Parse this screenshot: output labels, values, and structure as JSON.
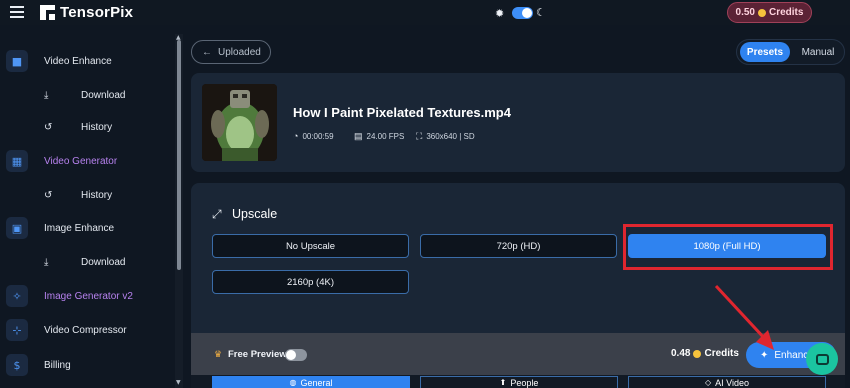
{
  "app": {
    "name": "TensorPix"
  },
  "header": {
    "credits": "0.50",
    "credits_label": "Credits",
    "theme_toggle": "dark"
  },
  "sidebar": {
    "items": [
      {
        "label": "Video Enhance",
        "icon": "video-camera-icon"
      },
      {
        "label": "Download",
        "icon": "download-icon",
        "sub": true
      },
      {
        "label": "History",
        "icon": "history-icon",
        "sub": true
      },
      {
        "label": "Video Generator",
        "icon": "film-icon",
        "accent": "#b782ef"
      },
      {
        "label": "History",
        "icon": "history-icon",
        "sub": true
      },
      {
        "label": "Image Enhance",
        "icon": "image-icon"
      },
      {
        "label": "Download",
        "icon": "download-icon",
        "sub": true
      },
      {
        "label": "Image Generator v2",
        "icon": "sparkle-wand-icon",
        "accent": "#b782ef"
      },
      {
        "label": "Video Compressor",
        "icon": "compress-icon"
      },
      {
        "label": "Billing",
        "icon": "dollar-icon"
      }
    ]
  },
  "main": {
    "back_label": "Uploaded",
    "mode_tabs": {
      "presets": "Presets",
      "manual": "Manual",
      "selected": "Presets"
    },
    "video": {
      "title": "How I Paint Pixelated Textures.mp4",
      "duration": "00:00:59",
      "fps": "24.00 FPS",
      "resolution": "360x640 | SD"
    },
    "upscale": {
      "title": "Upscale",
      "options": [
        "No Upscale",
        "720p (HD)",
        "1080p (Full HD)",
        "2160p (4K)"
      ],
      "selected": "1080p (Full HD)"
    },
    "footer": {
      "free_preview_label": "Free Preview",
      "free_preview_on": false,
      "cost": "0.48",
      "cost_label": "Credits",
      "enhance_label": "Enhance"
    },
    "preset_tabs": [
      {
        "label": "General",
        "icon": "globe-icon",
        "active": true
      },
      {
        "label": "People",
        "icon": "person-icon",
        "active": false
      },
      {
        "label": "AI Video",
        "icon": "ai-icon",
        "active": false
      }
    ]
  },
  "colors": {
    "accent": "#2f83f0",
    "highlight_frame": "#e0262f",
    "credits_pill": "#5b2235",
    "chat": "#1bc4a0"
  }
}
